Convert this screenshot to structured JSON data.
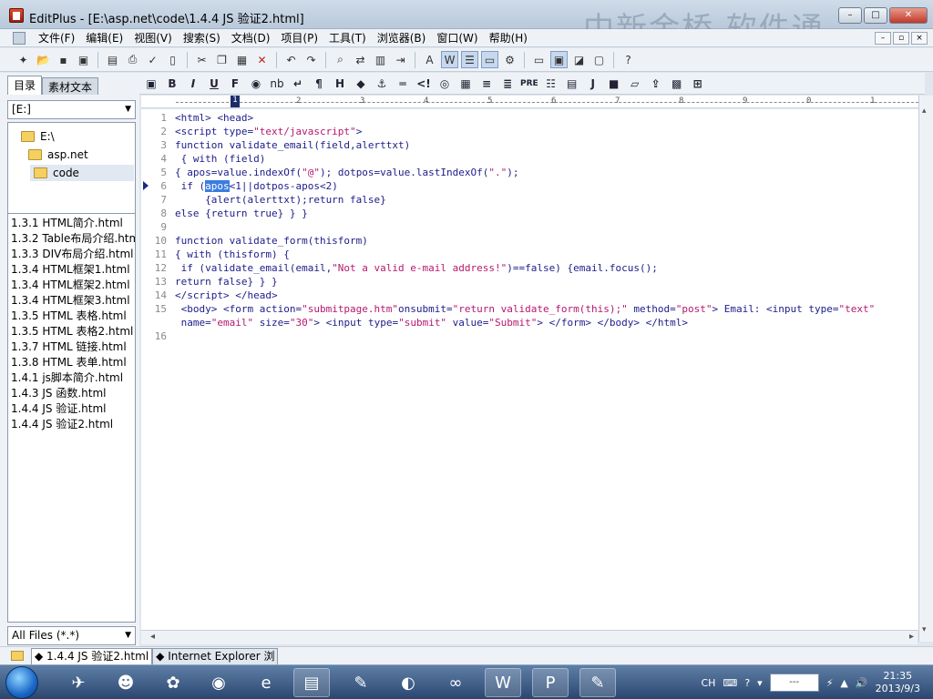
{
  "window": {
    "title": "EditPlus - [E:\\asp.net\\code\\1.4.4 JS 验证2.html]",
    "watermark": "中新金桥  软件通",
    "controls": [
      "–",
      "□",
      "✕"
    ]
  },
  "menu": {
    "items": [
      "文件(F)",
      "编辑(E)",
      "视图(V)",
      "搜索(S)",
      "文档(D)",
      "项目(P)",
      "工具(T)",
      "浏览器(B)",
      "窗口(W)",
      "帮助(H)"
    ],
    "right_controls": [
      "–",
      "▫",
      "×"
    ]
  },
  "left_pane": {
    "tabs": [
      "目录",
      "素材文本"
    ],
    "drive": "[E:]",
    "tree": [
      "E:\\",
      "asp.net",
      "code"
    ],
    "files": [
      "1.3.1 HTML简介.html",
      "1.3.2 Table布局介绍.htm",
      "1.3.3 DIV布局介绍.html",
      "1.3.4 HTML框架1.html",
      "1.3.4 HTML框架2.html",
      "1.3.4 HTML框架3.html",
      "1.3.5 HTML 表格.html",
      "1.3.5 HTML 表格2.html",
      "1.3.7 HTML 链接.html",
      "1.3.8 HTML 表单.html",
      "1.4.1 js脚本简介.html",
      "1.4.3 JS 函数.html",
      "1.4.4 JS 验证.html",
      "1.4.4 JS 验证2.html"
    ],
    "filter": "All Files (*.*)"
  },
  "html_toolbar": [
    "B",
    "I",
    "U",
    "F",
    "nb",
    "P",
    "H",
    "PRE",
    "J"
  ],
  "ruler": {
    "cursor": "1",
    "marks": [
      "1",
      "2",
      "3",
      "4",
      "5",
      "6",
      "7",
      "8",
      "9",
      "0",
      "1"
    ]
  },
  "editor": {
    "line_numbers": [
      "1",
      "2",
      "3",
      "4",
      "5",
      "6",
      "7",
      "8",
      "9",
      "10",
      "11",
      "12",
      "13",
      "14",
      "15",
      "16"
    ],
    "line6_selection": "apos"
  },
  "doc_tabs": [
    "1.4.4 JS 验证2.html",
    "Internet Explorer 浏"
  ],
  "taskbar": {
    "ime": "CH",
    "ime_box": "---",
    "time": "21:35",
    "date": "2013/9/3"
  }
}
